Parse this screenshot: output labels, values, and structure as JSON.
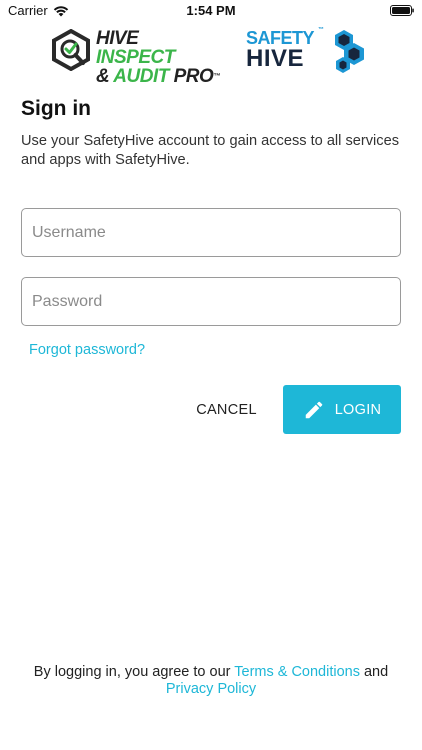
{
  "status_bar": {
    "carrier": "Carrier",
    "time": "1:54 PM",
    "wifi_icon": "wifi-icon",
    "battery_icon": "battery-icon"
  },
  "logos": {
    "hive_inspect": {
      "line1_dark": "HIVE ",
      "line1_green": "INSPECT",
      "line2_dark": "& ",
      "line2_green": "AUDIT ",
      "line2_dark2": "PRO",
      "tm": "™"
    },
    "safety_hive": {
      "line1": "SAFETY",
      "line2": "HIVE",
      "tm": "™"
    }
  },
  "signin": {
    "title": "Sign in",
    "subtitle": "Use your SafetyHive account to gain access to all services and apps with SafetyHive.",
    "username": {
      "value": "",
      "placeholder": "Username"
    },
    "password": {
      "value": "",
      "placeholder": "Password"
    },
    "forgot_password": "Forgot password?",
    "cancel_label": "CANCEL",
    "login_label": "LOGIN",
    "login_icon": "pencil-icon"
  },
  "footer": {
    "prefix": "By logging in, you agree to our ",
    "terms": "Terms & Conditions",
    "and": " and",
    "privacy": "Privacy Policy"
  },
  "colors": {
    "accent": "#1eb7d7",
    "hive_green": "#3bb54a",
    "safety_blue": "#1d97d4",
    "safety_navy": "#17263d"
  }
}
